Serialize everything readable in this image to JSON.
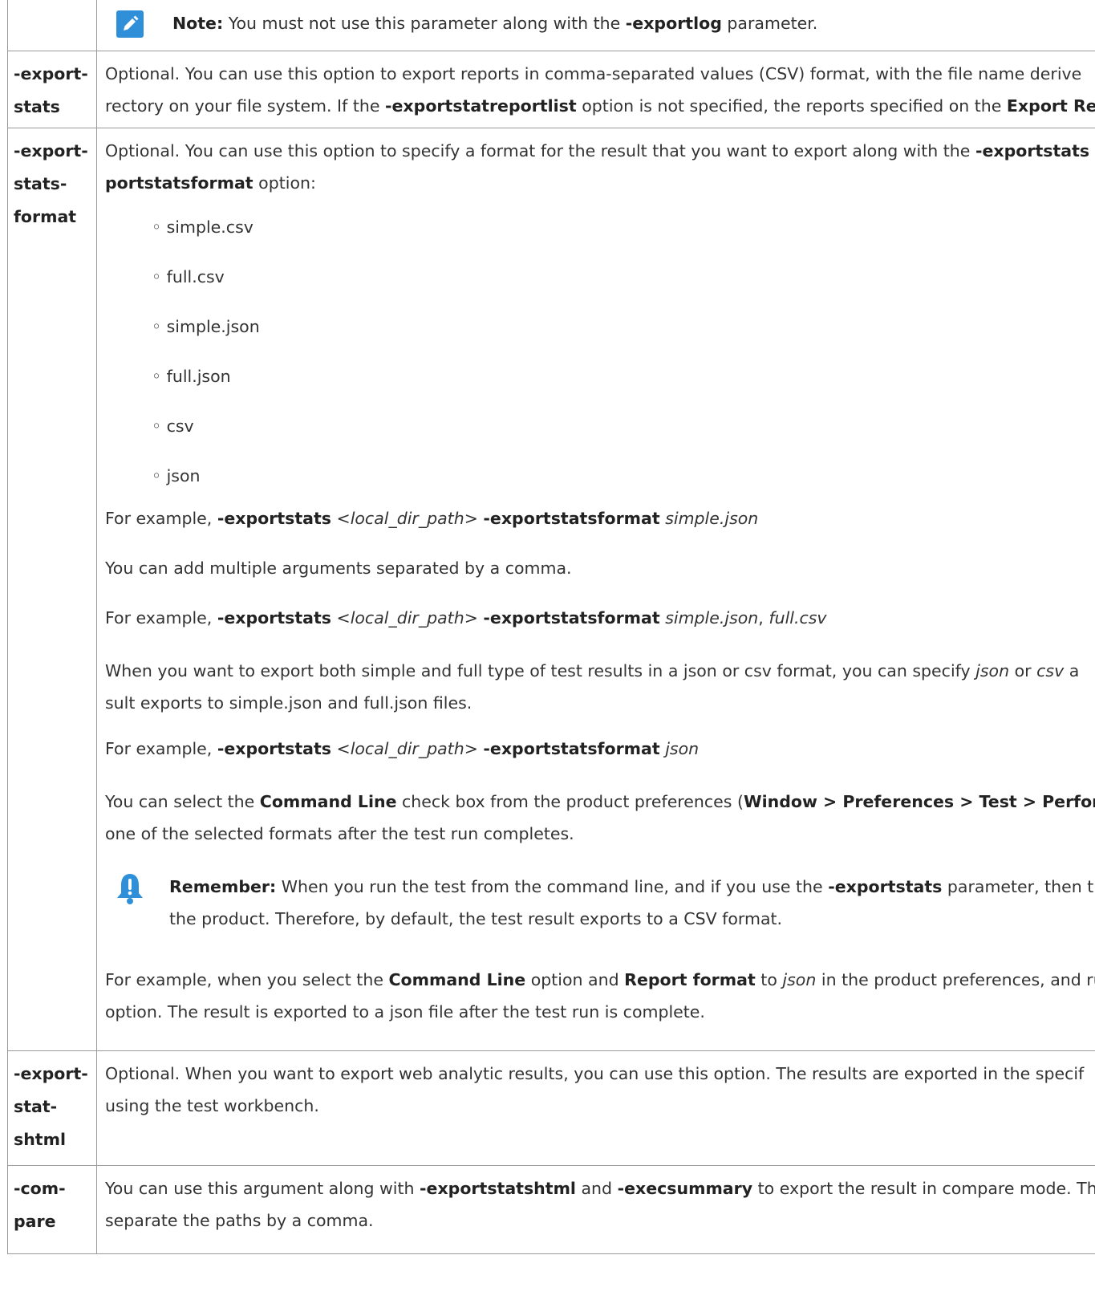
{
  "row0": {
    "note_label": "Note:",
    "note_pre": "You must not use this parameter along with the",
    "note_param": "-exportlog",
    "note_post": "parameter."
  },
  "row1": {
    "name": "-export-stats",
    "l1": "Optional. You can use this option to export reports in comma-separated values (CSV) format, with the file name derive",
    "l2_pre": "rectory on your file system. If the",
    "l2_bold": "-exportstatreportlist",
    "l2_mid": "option is not specified, the reports specified on the",
    "l2_bold2": "Export Repo"
  },
  "row2": {
    "name": "-export-stats-format",
    "intro1_pre": "Optional. You can use this option to specify a format for the result that you want to export along with the",
    "intro1_bold": "-exportstats",
    "intro2_bold": "portstatsformat",
    "intro2_post": "option:",
    "formats": [
      "simple.csv",
      "full.csv",
      "simple.json",
      "full.json",
      "csv",
      "json"
    ],
    "ex1_pre": "For example,",
    "ex1_b1": "-exportstats",
    "ex1_path": "<local_dir_path>",
    "ex1_b2": "-exportstatsformat",
    "ex1_val": "simple.json",
    "multi": "You can add multiple arguments separated by a comma.",
    "ex2_pre": "For example,",
    "ex2_b1": "-exportstats",
    "ex2_path": "<local_dir_path>",
    "ex2_b2": "-exportstatsformat",
    "ex2_val1": "simple.json",
    "ex2_sep": ",",
    "ex2_val2": "full.csv",
    "both1_pre": "When you want to export both simple and full type of test results in a json or csv format, you can specify",
    "both1_i1": "json",
    "both1_or": "or",
    "both1_i2": "csv",
    "both1_post": "a",
    "both2": "sult exports to simple.json and full.json files.",
    "ex3_pre": "For example,",
    "ex3_b1": "-exportstats",
    "ex3_path": "<local_dir_path>",
    "ex3_b2": "-exportstatsformat",
    "ex3_val": "json",
    "sel1_pre": "You can select the",
    "sel1_b1": "Command Line",
    "sel1_mid": "check box from the product preferences (",
    "sel1_b2": "Window > Preferences > Test > Performa",
    "sel2": "one of the selected formats after the test run completes.",
    "rem_label": "Remember:",
    "rem1_pre": "When you run the test from the command line, and if you use the",
    "rem1_bold": "-exportstats",
    "rem1_post": "parameter, then the",
    "rem2": "the product. Therefore, by default, the test result exports to a CSV format.",
    "fin1_pre": "For example, when you select the",
    "fin1_b1": "Command Line",
    "fin1_mid": "option and",
    "fin1_b2": "Report format",
    "fin1_to": "to",
    "fin1_i": "json",
    "fin1_post": "in the product preferences, and run",
    "fin2": "option. The result is exported to a json file after the test run is complete."
  },
  "row3": {
    "name": "-export-stat-shtml",
    "l1": "Optional. When you want to export web analytic results, you can use this option. The results are exported in the specif",
    "l2": "using the test workbench."
  },
  "row4": {
    "name": "-com-pare",
    "l1_pre": "You can use this argument along with",
    "l1_b1": "-exportstatshtml",
    "l1_and": "and",
    "l1_b2": "-execsummary",
    "l1_post": "to export the result in compare mode. The",
    "l2": "separate the paths by a comma."
  },
  "colors": {
    "icon_blue": "#2f8fd8",
    "border": "#999999",
    "text": "#333333"
  },
  "icons": {
    "note": "pencil-icon",
    "remember": "bell-icon"
  }
}
